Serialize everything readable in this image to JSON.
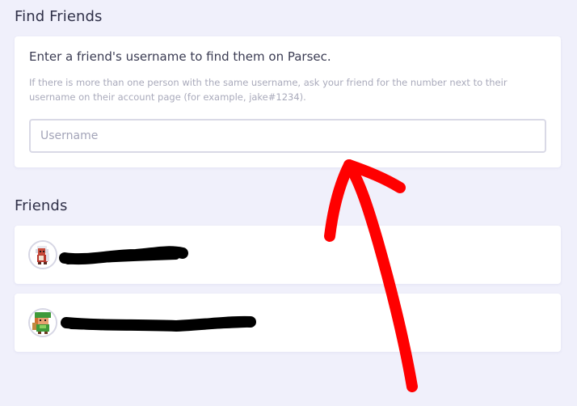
{
  "find_friends": {
    "section_title": "Find Friends",
    "heading": "Enter a friend's username to find them on Parsec.",
    "hint": "If there is more than one person with the same username, ask your friend for the number next to their username on their account page (for example, jake#1234).",
    "input_placeholder": "Username",
    "input_value": ""
  },
  "friends": {
    "section_title": "Friends",
    "items": [
      {
        "avatar_icon": "pixel-character-avatar-icon",
        "name_redacted": true
      },
      {
        "avatar_icon": "pixel-character-avatar-icon",
        "name_redacted": true
      }
    ]
  },
  "colors": {
    "background": "#f0f0fb",
    "card": "#ffffff",
    "annotation_arrow": "#ff0000",
    "redaction": "#000000"
  }
}
